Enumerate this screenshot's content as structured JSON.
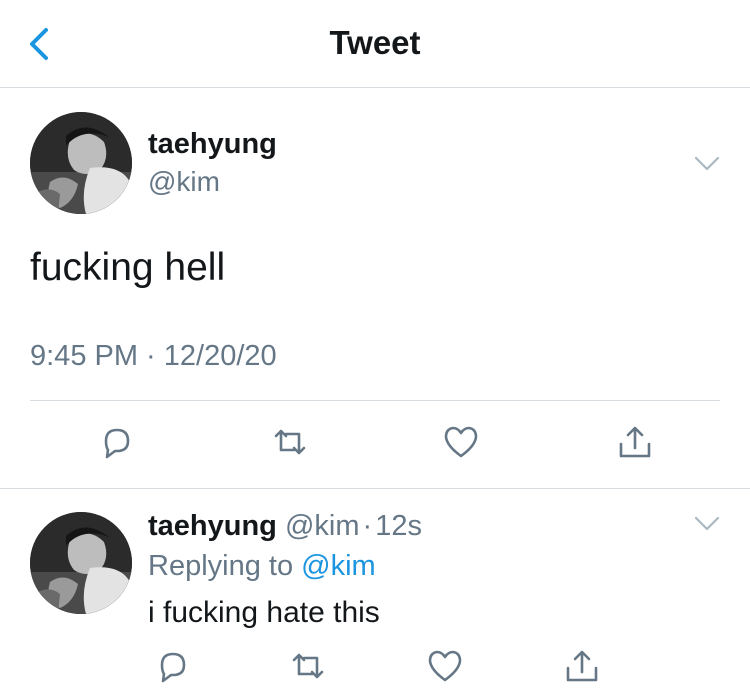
{
  "nav": {
    "title": "Tweet",
    "back_icon": "chevron-left-icon",
    "accent": "#1b95e0"
  },
  "tweet": {
    "display_name": "taehyung",
    "handle": "@kim",
    "text": "fucking hell",
    "timestamp": "9:45 PM · 12/20/20",
    "actions": [
      "reply-icon",
      "retweet-icon",
      "like-icon",
      "share-icon"
    ]
  },
  "reply": {
    "display_name": "taehyung",
    "handle": "@kim",
    "separator": "·",
    "time": "12s",
    "replying_prefix": "Replying to",
    "replying_handle": "@kim",
    "text": "i fucking hate this",
    "actions": [
      "reply-icon",
      "retweet-icon",
      "like-icon",
      "share-icon"
    ]
  },
  "colors": {
    "text": "#14171a",
    "secondary": "#657786",
    "link": "#1b95e0",
    "divider": "#d8dde1"
  }
}
